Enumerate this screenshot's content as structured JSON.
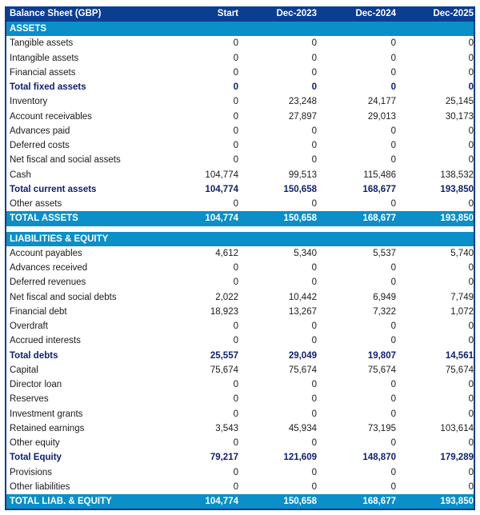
{
  "table": {
    "title": "Balance Sheet (GBP)",
    "columns": [
      "Start",
      "Dec-2023",
      "Dec-2024",
      "Dec-2025"
    ],
    "colors": {
      "header_bg": "#0b3d91",
      "section_bg": "#0a8fc8",
      "total_text": "#0d1f6b"
    },
    "assets": {
      "section_label": "ASSETS",
      "rows": [
        {
          "label": "Tangible assets",
          "type": "item",
          "values": [
            "0",
            "0",
            "0",
            "0"
          ]
        },
        {
          "label": "Intangible assets",
          "type": "item",
          "values": [
            "0",
            "0",
            "0",
            "0"
          ]
        },
        {
          "label": "Financial assets",
          "type": "item",
          "values": [
            "0",
            "0",
            "0",
            "0"
          ]
        },
        {
          "label": "Total fixed assets",
          "type": "total",
          "values": [
            "0",
            "0",
            "0",
            "0"
          ]
        },
        {
          "label": "Inventory",
          "type": "item",
          "values": [
            "0",
            "23,248",
            "24,177",
            "25,145"
          ]
        },
        {
          "label": "Account receivables",
          "type": "item",
          "values": [
            "0",
            "27,897",
            "29,013",
            "30,173"
          ]
        },
        {
          "label": "Advances paid",
          "type": "item",
          "values": [
            "0",
            "0",
            "0",
            "0"
          ]
        },
        {
          "label": "Deferred costs",
          "type": "item",
          "values": [
            "0",
            "0",
            "0",
            "0"
          ]
        },
        {
          "label": "Net fiscal and social assets",
          "type": "item",
          "values": [
            "0",
            "0",
            "0",
            "0"
          ]
        },
        {
          "label": "Cash",
          "type": "item",
          "values": [
            "104,774",
            "99,513",
            "115,486",
            "138,532"
          ]
        },
        {
          "label": "Total current assets",
          "type": "total",
          "values": [
            "104,774",
            "150,658",
            "168,677",
            "193,850"
          ]
        },
        {
          "label": "Other assets",
          "type": "item",
          "values": [
            "0",
            "0",
            "0",
            "0"
          ]
        }
      ],
      "grand_total": {
        "label": "TOTAL ASSETS",
        "values": [
          "104,774",
          "150,658",
          "168,677",
          "193,850"
        ]
      }
    },
    "liabilities": {
      "section_label": "LIABILITIES & EQUITY",
      "rows": [
        {
          "label": "Account payables",
          "type": "item",
          "values": [
            "4,612",
            "5,340",
            "5,537",
            "5,740"
          ]
        },
        {
          "label": "Advances received",
          "type": "item",
          "values": [
            "0",
            "0",
            "0",
            "0"
          ]
        },
        {
          "label": "Deferred revenues",
          "type": "item",
          "values": [
            "0",
            "0",
            "0",
            "0"
          ]
        },
        {
          "label": "Net fiscal and social debts",
          "type": "item",
          "values": [
            "2,022",
            "10,442",
            "6,949",
            "7,749"
          ]
        },
        {
          "label": "Financial debt",
          "type": "item",
          "values": [
            "18,923",
            "13,267",
            "7,322",
            "1,072"
          ]
        },
        {
          "label": "Overdraft",
          "type": "item",
          "values": [
            "0",
            "0",
            "0",
            "0"
          ]
        },
        {
          "label": "Accrued interests",
          "type": "item",
          "values": [
            "0",
            "0",
            "0",
            "0"
          ]
        },
        {
          "label": "Total debts",
          "type": "total",
          "values": [
            "25,557",
            "29,049",
            "19,807",
            "14,561"
          ]
        },
        {
          "label": "Capital",
          "type": "item",
          "values": [
            "75,674",
            "75,674",
            "75,674",
            "75,674"
          ]
        },
        {
          "label": "Director loan",
          "type": "item",
          "values": [
            "0",
            "0",
            "0",
            "0"
          ]
        },
        {
          "label": "Reserves",
          "type": "item",
          "values": [
            "0",
            "0",
            "0",
            "0"
          ]
        },
        {
          "label": "Investment grants",
          "type": "item",
          "values": [
            "0",
            "0",
            "0",
            "0"
          ]
        },
        {
          "label": "Retained earnings",
          "type": "item",
          "values": [
            "3,543",
            "45,934",
            "73,195",
            "103,614"
          ]
        },
        {
          "label": "Other equity",
          "type": "item",
          "values": [
            "0",
            "0",
            "0",
            "0"
          ]
        },
        {
          "label": "Total Equity",
          "type": "total",
          "values": [
            "79,217",
            "121,609",
            "148,870",
            "179,289"
          ]
        },
        {
          "label": "Provisions",
          "type": "item",
          "values": [
            "0",
            "0",
            "0",
            "0"
          ]
        },
        {
          "label": "Other liabilities",
          "type": "item",
          "values": [
            "0",
            "0",
            "0",
            "0"
          ]
        }
      ],
      "grand_total": {
        "label": "TOTAL LIAB. & EQUITY",
        "values": [
          "104,774",
          "150,658",
          "168,677",
          "193,850"
        ]
      }
    }
  }
}
